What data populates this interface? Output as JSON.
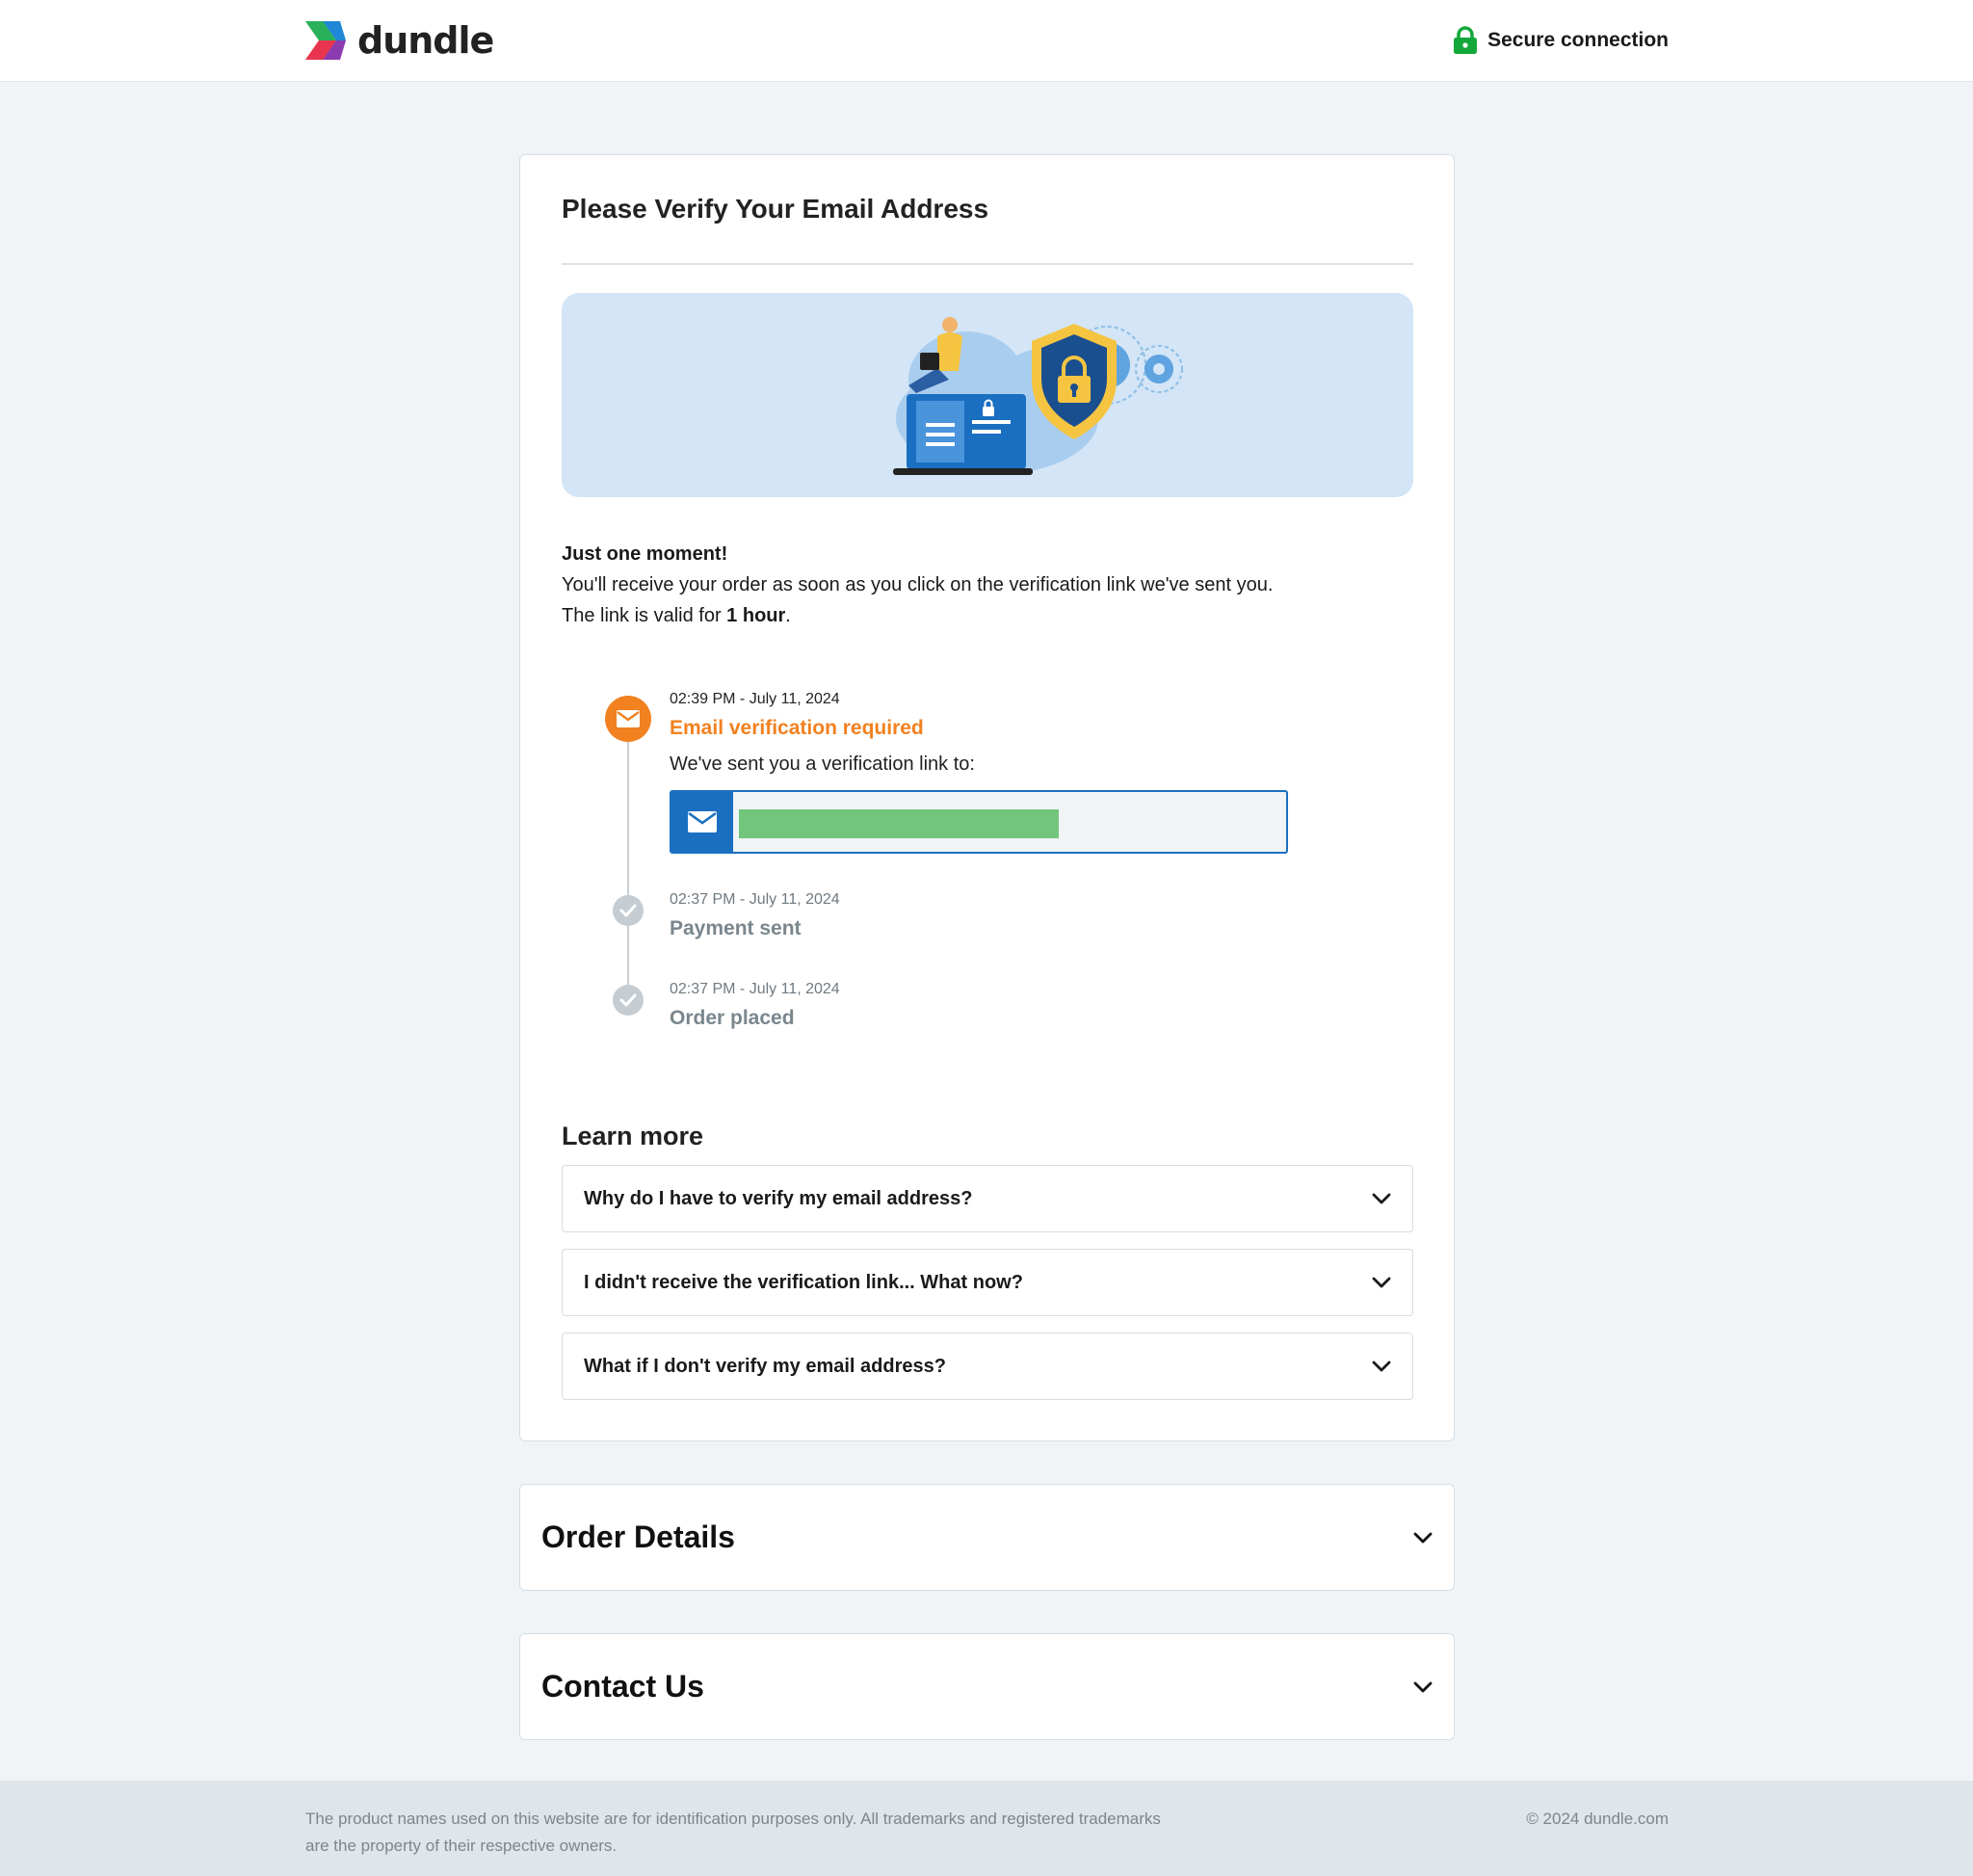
{
  "header": {
    "brand": "dundle",
    "secure_label": "Secure connection"
  },
  "verify": {
    "title": "Please Verify Your Email Address",
    "heading": "Just one moment!",
    "line1": "You'll receive your order as soon as you click on the verification link we've sent you.",
    "line2_prefix": "The link is valid for ",
    "line2_bold": "1 hour",
    "line2_suffix": "."
  },
  "timeline": [
    {
      "time": "02:39 PM - July 11, 2024",
      "title": "Email verification required",
      "subtitle": "We've sent you a verification link to:",
      "status": "active",
      "icon": "envelope-icon"
    },
    {
      "time": "02:37 PM - July 11, 2024",
      "title": "Payment sent",
      "status": "done",
      "icon": "check-icon"
    },
    {
      "time": "02:37 PM - July 11, 2024",
      "title": "Order placed",
      "status": "done",
      "icon": "check-icon"
    }
  ],
  "learn_more": {
    "title": "Learn more",
    "faqs": [
      {
        "question": "Why do I have to verify my email address?"
      },
      {
        "question": "I didn't receive the verification link... What now?"
      },
      {
        "question": "What if I don't verify my email address?"
      }
    ]
  },
  "sections": {
    "order_details": "Order Details",
    "contact_us": "Contact Us"
  },
  "footer": {
    "note": "The product names used on this website are for identification purposes only. All trademarks and registered trademarks are the property of their respective owners.",
    "copyright": "© 2024 dundle.com"
  },
  "colors": {
    "accent_orange": "#f28120",
    "accent_blue": "#1a6fc1",
    "secure_green": "#14a83b",
    "background": "#f0f4f7",
    "redaction_green": "#71c67b"
  }
}
